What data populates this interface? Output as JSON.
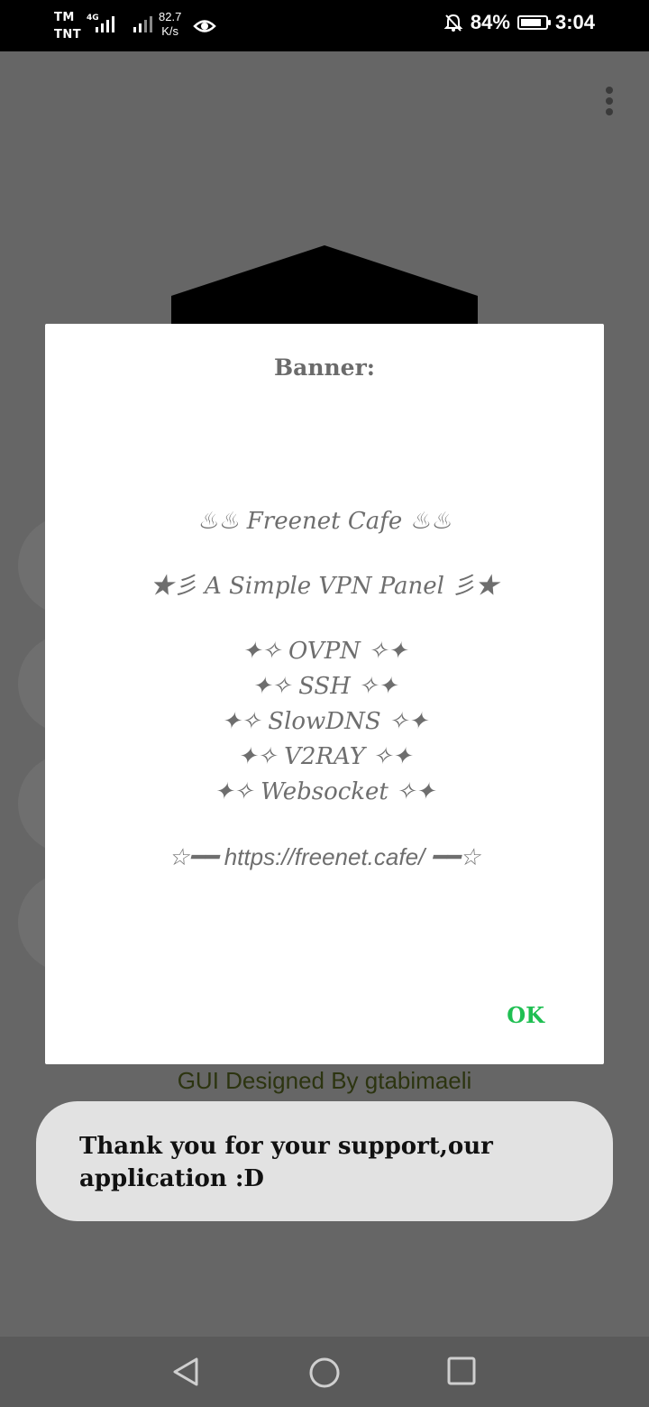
{
  "status_bar": {
    "carrier_1": "TM",
    "carrier_2": "TNT",
    "network_type": "4G",
    "net_speed_value": "82.7",
    "net_speed_unit": "K/s",
    "battery_percent": "84%",
    "battery_level": 0.84,
    "time": "3:04"
  },
  "background": {
    "credit_text": "GUI  Designed By gtabimaeli"
  },
  "dialog": {
    "title": "Banner:",
    "banner_lines": [
      "♨♨ Freenet Cafe ♨♨",
      "★彡 A Simple VPN Panel 彡★",
      "✦✧ OVPN ✧✦",
      "✦✧ SSH ✧✦",
      "✦✧ SlowDNS ✧✦",
      "✦✧ V2RAY ✧✦",
      "✦✧ Websocket ✧✦",
      "☆━━ https://freenet.cafe/ ━━☆"
    ],
    "ok_label": "OK"
  },
  "toast": {
    "message": "Thank you for your support,our application :D"
  },
  "icons": {
    "overflow": "more-vert-icon",
    "back": "back-triangle-icon",
    "home": "home-circle-icon",
    "recents": "recents-square-icon"
  },
  "colors": {
    "scrim": "#666666",
    "ok_green": "#1fbf52",
    "credit_text": "#2c3410"
  }
}
